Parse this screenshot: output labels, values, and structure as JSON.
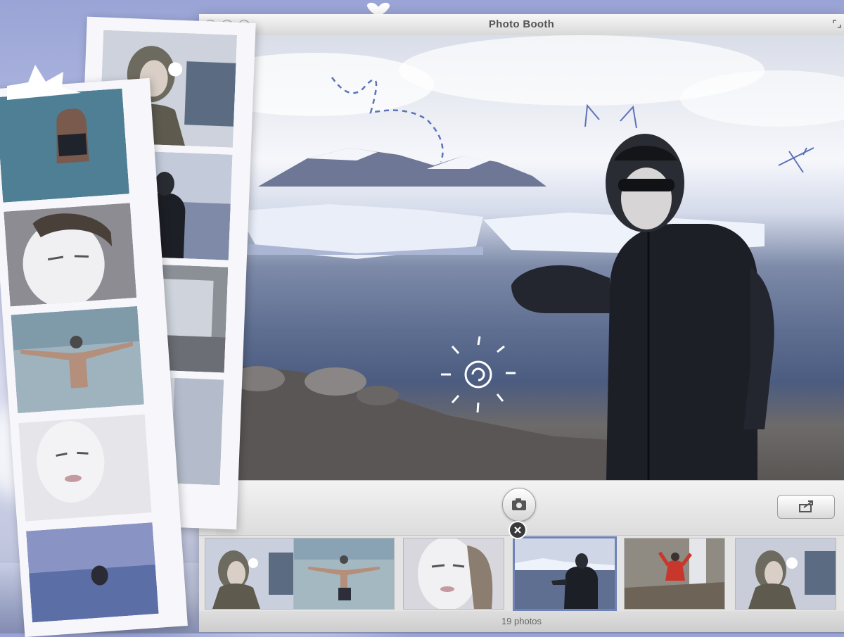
{
  "window": {
    "title": "Photo Booth",
    "status": "19 photos"
  },
  "controls": {
    "shutter_icon": "camera-icon",
    "share_icon": "share-icon"
  },
  "thumbnails": [
    {
      "name": "mirror-selfie-hood",
      "selected": false
    },
    {
      "name": "arms-out-hot-spring",
      "selected": false
    },
    {
      "name": "face-mask-closeup",
      "selected": false
    },
    {
      "name": "glacier-lagoon-jacket",
      "selected": true
    },
    {
      "name": "waterfall-red-jacket",
      "selected": false
    },
    {
      "name": "mirror-selfie-flash",
      "selected": false
    }
  ],
  "colors": {
    "background": "#b8c0e4",
    "window": "#e4e4e4",
    "selection": "#6f83b8",
    "doodle": "#5d72b8"
  }
}
